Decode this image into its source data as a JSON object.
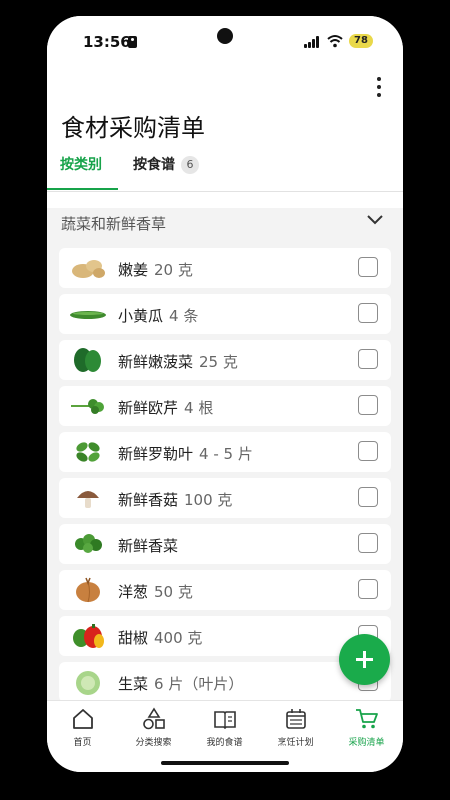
{
  "status": {
    "time": "13:56",
    "battery": "78"
  },
  "header": {
    "title": "食材采购清单"
  },
  "tabs": [
    {
      "label": "按类别"
    },
    {
      "label": "按食谱",
      "count": "6"
    }
  ],
  "section": {
    "title": "蔬菜和新鲜香草"
  },
  "items": [
    {
      "name": "嫩姜",
      "qty": "20 克",
      "icon": "ginger-icon"
    },
    {
      "name": "小黄瓜",
      "qty": "4 条",
      "icon": "cucumber-icon"
    },
    {
      "name": "新鲜嫩菠菜",
      "qty": "25 克",
      "icon": "spinach-icon"
    },
    {
      "name": "新鲜欧芹",
      "qty": "4 根",
      "icon": "parsley-icon"
    },
    {
      "name": "新鲜罗勒叶",
      "qty": "4 - 5 片",
      "icon": "basil-icon"
    },
    {
      "name": "新鲜香菇",
      "qty": "100 克",
      "icon": "mushroom-icon"
    },
    {
      "name": "新鲜香菜",
      "qty": "",
      "icon": "cilantro-icon"
    },
    {
      "name": "洋葱",
      "qty": "50 克",
      "icon": "onion-icon"
    },
    {
      "name": "甜椒",
      "qty": "400 克",
      "icon": "bell-pepper-icon"
    },
    {
      "name": "生菜",
      "qty": "6 片（叶片）",
      "icon": "lettuce-icon"
    }
  ],
  "nav": [
    {
      "label": "首页",
      "icon": "home-icon"
    },
    {
      "label": "分类搜索",
      "icon": "shapes-icon"
    },
    {
      "label": "我的食谱",
      "icon": "book-icon"
    },
    {
      "label": "烹饪计划",
      "icon": "calendar-icon"
    },
    {
      "label": "采购清单",
      "icon": "cart-icon"
    }
  ],
  "colors": {
    "accent": "#17a34a",
    "fab": "#1aab4b"
  }
}
